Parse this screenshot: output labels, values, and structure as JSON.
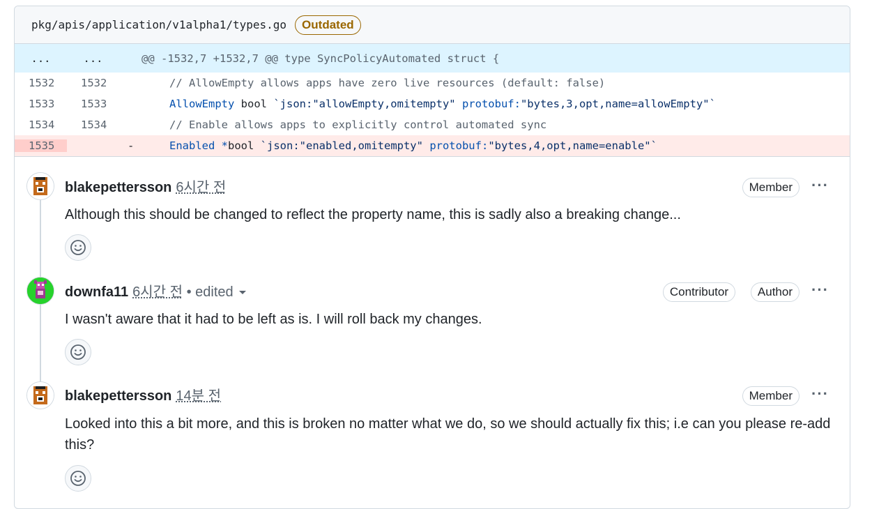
{
  "file": {
    "path": "pkg/apis/application/v1alpha1/types.go",
    "status_badge": "Outdated"
  },
  "diff": {
    "hunk": {
      "left_dots": "...",
      "right_dots": "...",
      "header": "@@ -1532,7 +1532,7 @@ type SyncPolicyAutomated struct {"
    },
    "rows": [
      {
        "old": "1532",
        "new": "1532",
        "sign": "",
        "code": "// AllowEmpty allows apps have zero live resources (default: false)"
      },
      {
        "old": "1533",
        "new": "1533",
        "sign": "",
        "field": "AllowEmpty",
        "type": " bool ",
        "tag_start": "`json:",
        "tag1": "\"allowEmpty,omitempty\"",
        "tag_mid": " protobuf:",
        "tag2": "\"bytes,3,opt,name=allowEmpty\"",
        "tag_end": "`"
      },
      {
        "old": "1534",
        "new": "1534",
        "sign": "",
        "code": "// Enable allows apps to explicitly control automated sync"
      },
      {
        "old": "1535",
        "new": "",
        "sign": "-",
        "field": "Enabled",
        "ptr": " *",
        "type": "bool ",
        "tag_start": "`json:",
        "tag1": "\"enabled,omitempty\"",
        "tag_mid": " protobuf:",
        "tag2": "\"bytes,4,opt,name=enable\"",
        "tag_end": "`"
      }
    ]
  },
  "comments": [
    {
      "author": "blakepettersson",
      "time": "6시간 전",
      "badges": [
        "Member"
      ],
      "body": "Although this should be changed to reflect the property name, this is sadly also a breaking change..."
    },
    {
      "author": "downfa11",
      "time": "6시간 전",
      "edited": "• edited",
      "badges": [
        "Contributor",
        "Author"
      ],
      "body": "I wasn't aware that it had to be left as is. I will roll back my changes."
    },
    {
      "author": "blakepettersson",
      "time": "14분 전",
      "badges": [
        "Member"
      ],
      "body": "Looked into this a bit more, and this is broken no matter what we do, so we should actually fix this; i.e can you please re-add this?"
    }
  ],
  "more_icon": "···",
  "colors": {
    "outdated": "#9a6700",
    "hunk_bg": "#ddf4ff",
    "deleted_bg": "#ffebe9",
    "keyword": "#0550ae"
  }
}
